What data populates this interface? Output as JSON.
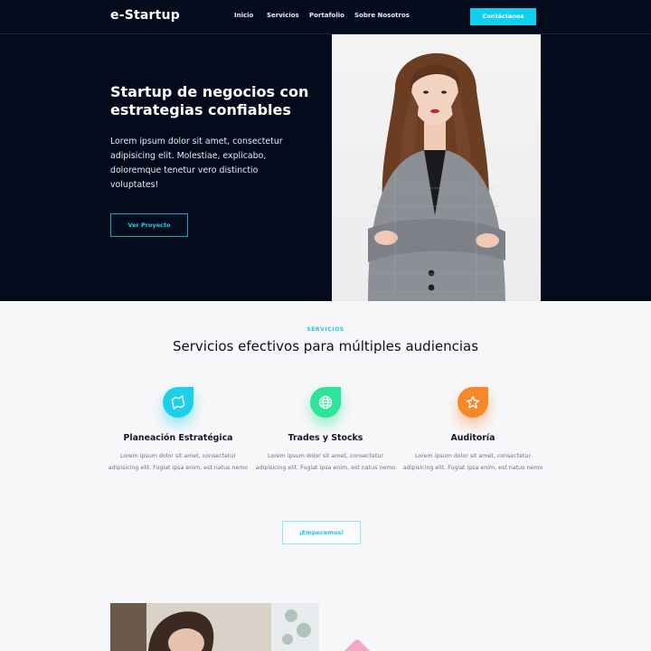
{
  "nav": {
    "logo": "e-Startup",
    "links": [
      "Inicio",
      "Servicios",
      "Portafolio",
      "Sobre Nosotros"
    ],
    "cta": "Contáctanos"
  },
  "hero": {
    "title": "Startup de negocios con estrategias confiables",
    "text": "Lorem ipsum dolor sit amet, consectetur adipisicing elit. Molestiae, explicabo, doloremque tenetur vero distinctio voluptates!",
    "button": "Ver Proyecto"
  },
  "services": {
    "eyebrow": "SERVICIOS",
    "title": "Servicios efectivos para múltiples audiencias",
    "items": [
      {
        "name": "Planeación Estratégica",
        "desc": "Lorem ipsum dolor sit amet, consectetur adipisicing elit. Fugiat ipsa enim, est natus nemo",
        "icon": "map-icon",
        "color": "#1ecfe9"
      },
      {
        "name": "Trades y Stocks",
        "desc": "Lorem ipsum dolor sit amet, consectetur adipisicing elit. Fugiat ipsa enim, est natus nemo",
        "icon": "globe-icon",
        "color": "#2ee49a"
      },
      {
        "name": "Auditoría",
        "desc": "Lorem ipsum dolor sit amet, consectetur adipisicing elit. Fugiat ipsa enim, est natus nemo",
        "icon": "star-icon",
        "color": "#f6882c"
      }
    ],
    "button": "¡Empecemos!"
  },
  "colors": {
    "accent": "#11d0ef",
    "dark": "#040b1c"
  }
}
